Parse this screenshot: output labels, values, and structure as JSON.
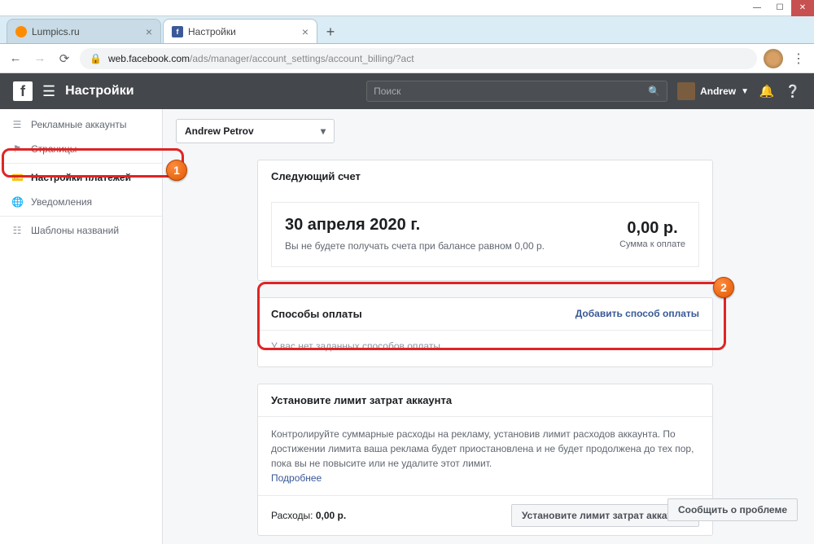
{
  "window": {
    "tabs": [
      {
        "label": "Lumpics.ru"
      },
      {
        "label": "Настройки"
      }
    ]
  },
  "addressbar": {
    "domain": "web.facebook.com",
    "path": "/ads/manager/account_settings/account_billing/?act"
  },
  "fb": {
    "title": "Настройки",
    "search_placeholder": "Поиск",
    "user": "Andrew"
  },
  "sidebar": {
    "items": [
      {
        "label": "Рекламные аккаунты"
      },
      {
        "label": "Страницы"
      },
      {
        "label": "Настройки платежей"
      },
      {
        "label": "Уведомления"
      },
      {
        "label": "Шаблоны названий"
      }
    ]
  },
  "account_selector": "Andrew Petrov",
  "next_bill": {
    "header": "Следующий счет",
    "date": "30 апреля 2020 г.",
    "note": "Вы не будете получать счета при балансе равном 0,00 р.",
    "amount": "0,00 р.",
    "amount_label": "Сумма к оплате"
  },
  "payment_methods": {
    "header": "Способы оплаты",
    "add_link": "Добавить способ оплаты",
    "empty": "У вас нет заданных способов оплаты."
  },
  "spend_limit": {
    "header": "Установите лимит затрат аккаунта",
    "desc": "Контролируйте суммарные расходы на рекламу, установив лимит расходов аккаунта. По достижении лимита ваша реклама будет приостановлена и не будет продолжена до тех пор, пока вы не повысите или не удалите этот лимит.",
    "more": "Подробнее",
    "footer_label": "Расходы: ",
    "footer_value": "0,00 р.",
    "button": "Установите лимит затрат аккаунта"
  },
  "report_button": "Сообщить о проблеме",
  "annotations": {
    "b1": "1",
    "b2": "2"
  }
}
